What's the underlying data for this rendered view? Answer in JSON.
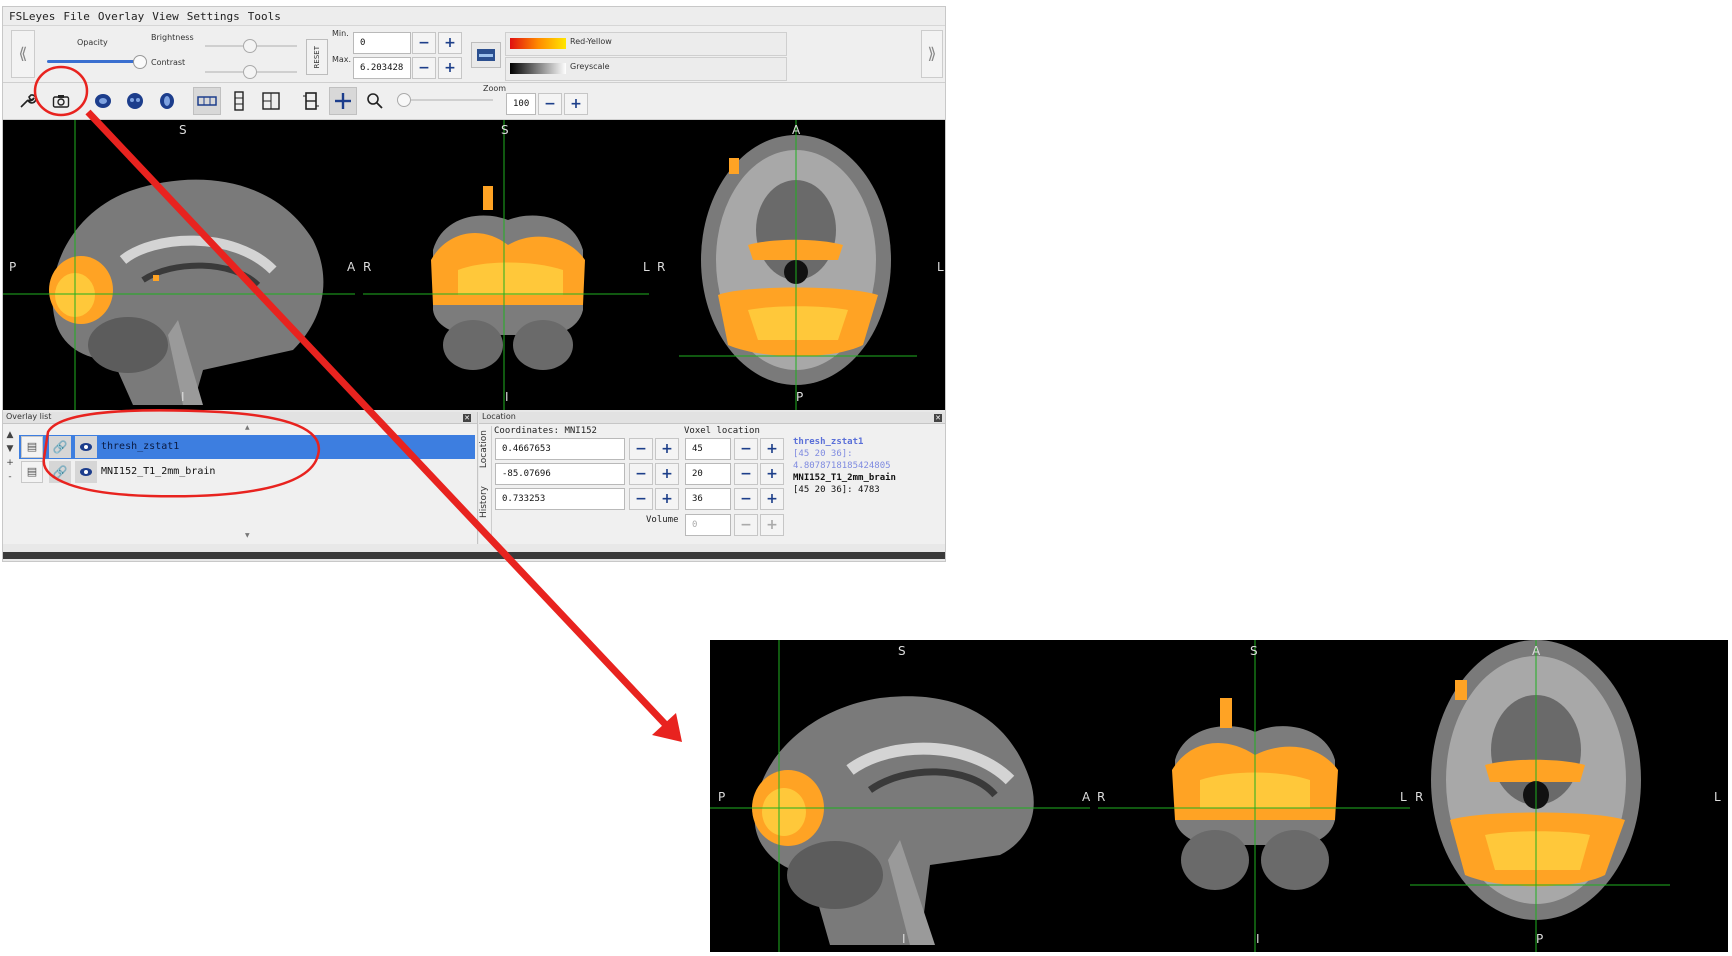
{
  "menubar": [
    "FSLeyes",
    "File",
    "Overlay",
    "View",
    "Settings",
    "Tools"
  ],
  "display": {
    "opacity_label": "Opacity",
    "brightness_label": "Brightness",
    "contrast_label": "Contrast",
    "reset_label": "RESET",
    "min_label": "Min.",
    "max_label": "Max.",
    "min_value": "0",
    "max_value": "6.203428",
    "cmap1": "Red-Yellow",
    "cmap2": "Greyscale"
  },
  "toolbar": {
    "zoom_label": "Zoom",
    "zoom_value": "100"
  },
  "views": {
    "sag": {
      "top": "S",
      "left": "P",
      "right": "A",
      "bottom": "I"
    },
    "cor": {
      "top": "S",
      "left": "R",
      "right": "L",
      "bottom": "I"
    },
    "axi": {
      "top": "A",
      "left": "R",
      "right": "L",
      "bottom": "P"
    }
  },
  "overlay_list": {
    "title": "Overlay list",
    "items": [
      {
        "name": "thresh_zstat1",
        "selected": true
      },
      {
        "name": "MNI152_T1_2mm_brain",
        "selected": false
      }
    ]
  },
  "location": {
    "title": "Location",
    "tabs": [
      "Location",
      "History"
    ],
    "coords_label": "Coordinates: MNI152",
    "voxel_label": "Voxel location",
    "coords": [
      "0.4667653",
      "-85.07696",
      "0.733253"
    ],
    "voxels": [
      "45",
      "20",
      "36"
    ],
    "volume_label": "Volume",
    "volume_value": "0",
    "info": [
      {
        "text": "thresh_zstat1",
        "style": "name-blue"
      },
      {
        "text": "[45 20 36]:",
        "style": "blue"
      },
      {
        "text": "4.8078718185424805",
        "style": "blue"
      },
      {
        "text": "MNI152_T1_2mm_brain",
        "style": "name-black"
      },
      {
        "text": "[45 20 36]: 4783",
        "style": "black"
      }
    ]
  },
  "colors": {
    "annotation": "#e8231f",
    "crosshair": "#1fb01f",
    "selected": "#3d7ee0"
  }
}
